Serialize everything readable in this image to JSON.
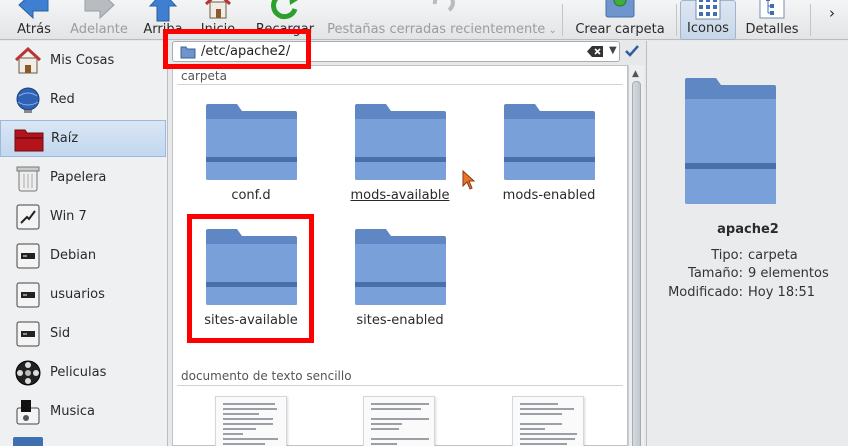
{
  "toolbar": {
    "back": "Atrás",
    "forward": "Adelante",
    "up": "Arriba",
    "home": "Inicio",
    "reload": "Recargar",
    "closed_tabs": "Pestañas cerradas recientemente",
    "new_folder": "Crear carpeta",
    "icons_view": "Iconos",
    "details_view": "Detalles",
    "more": "›"
  },
  "sidebar": {
    "items": [
      {
        "label": "Mis Cosas",
        "icon": "home-icon"
      },
      {
        "label": "Red",
        "icon": "network-globe-icon"
      },
      {
        "label": "Raíz",
        "icon": "root-folder-icon"
      },
      {
        "label": "Papelera",
        "icon": "trash-icon"
      },
      {
        "label": "Win 7",
        "icon": "drive-icon"
      },
      {
        "label": "Debian",
        "icon": "drive-icon"
      },
      {
        "label": "usuarios",
        "icon": "drive-icon"
      },
      {
        "label": "Sid",
        "icon": "drive-icon"
      },
      {
        "label": "Peliculas",
        "icon": "film-reel-icon"
      },
      {
        "label": "Musica",
        "icon": "music-drive-icon"
      }
    ],
    "selected": "Raíz"
  },
  "location": {
    "path": "/etc/apache2/"
  },
  "view": {
    "group_folders": "carpeta",
    "group_text": "documento de texto sencillo",
    "folders": [
      "conf.d",
      "mods-available",
      "mods-enabled",
      "sites-available",
      "sites-enabled"
    ],
    "docs": [
      {
        "lines": [
          "# This is the main Apache",
          "server configuration file.",
          "It contains the",
          "configuration directives",
          "that give the server its",
          "instructions.",
          "# See",
          "http://httpd.apache.org/doc",
          "s/2.2/ for detailed",
          "information about"
        ]
      },
      {
        "lines": [
          "# envvars - default environment",
          "variables for apache2ctl",
          "",
          "# this won't be correct after",
          "changing uid",
          "unset HOME",
          "",
          "# for supporting multiple apache2",
          "instances",
          "#"
        ]
      },
      {
        "lines": [
          "# Magic data for",
          "mod_mime_magic (originally",
          "for file(1) command",
          "",
          "# The format is 4-5",
          "columns:",
          "#     Column #1: byte number",
          "to begin checking from, \">\"",
          "indicates continuation",
          "#     Column #2: type of"
        ]
      }
    ]
  },
  "info": {
    "name": "apache2",
    "rows": [
      {
        "key": "Tipo:",
        "value": "carpeta"
      },
      {
        "key": "Tamaño:",
        "value": "9 elementos"
      },
      {
        "key": "Modificado:",
        "value": "Hoy 18:51"
      }
    ]
  },
  "colors": {
    "folder_blue": "#6f95cf",
    "selection": "#c3d7ee",
    "annotation_red": "#ff0000"
  }
}
